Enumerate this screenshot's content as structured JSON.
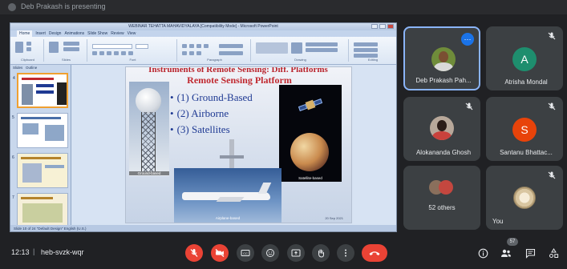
{
  "top_bar": {
    "title": "Deb Prakash is presenting"
  },
  "presentation": {
    "window_title": "WEBINAR TEHATTA MAHAVIDYALAYA [Compatibility Mode] - Microsoft PowerPoint",
    "ribbon_tabs": [
      "Home",
      "Insert",
      "Design",
      "Animations",
      "Slide Show",
      "Review",
      "View"
    ],
    "ribbon_groups": [
      "Clipboard",
      "Slides",
      "Font",
      "Paragraph",
      "Drawing",
      "Editing"
    ],
    "thumb_tabs": [
      "Slides",
      "Outline"
    ],
    "slide_numbers": [
      "4",
      "5",
      "6",
      "7"
    ],
    "slide": {
      "heading_top": "Instruments of Remote Sensing: Diff. Platforms",
      "heading": "Remote Sensing Platform",
      "bullets": [
        "(1) Ground-Based",
        "(2) Airborne",
        "(3) Satellites"
      ],
      "ground_label": "Ground-based",
      "satellite_label": "Satellite-based",
      "airplane_label": "Airplane-based",
      "corner_note": "20 Sep 2021"
    },
    "status_bar": "Slide 10 of 24   \"Default Design\"   English (U.S.)"
  },
  "participants": [
    {
      "name": "Deb Prakash Pah...",
      "type": "photo",
      "active": true
    },
    {
      "name": "Atrisha Mondal",
      "type": "letter",
      "letter": "A",
      "color": "#1e8e6e",
      "muted": true
    },
    {
      "name": "Alokananda Ghosh",
      "type": "photo",
      "muted": true
    },
    {
      "name": "Santanu Bhattac...",
      "type": "letter",
      "letter": "S",
      "color": "#e8430a",
      "muted": true
    },
    {
      "name": "52 others",
      "type": "others"
    },
    {
      "name": "You",
      "type": "you",
      "muted": true
    }
  ],
  "meeting": {
    "time": "12:13",
    "separator": "|",
    "code": "heb-svzk-wqr",
    "participants_count": "57"
  },
  "colors": {
    "accent": "#8ab4f8",
    "danger": "#ea4335",
    "tile": "#3c4043",
    "background": "#202124"
  }
}
